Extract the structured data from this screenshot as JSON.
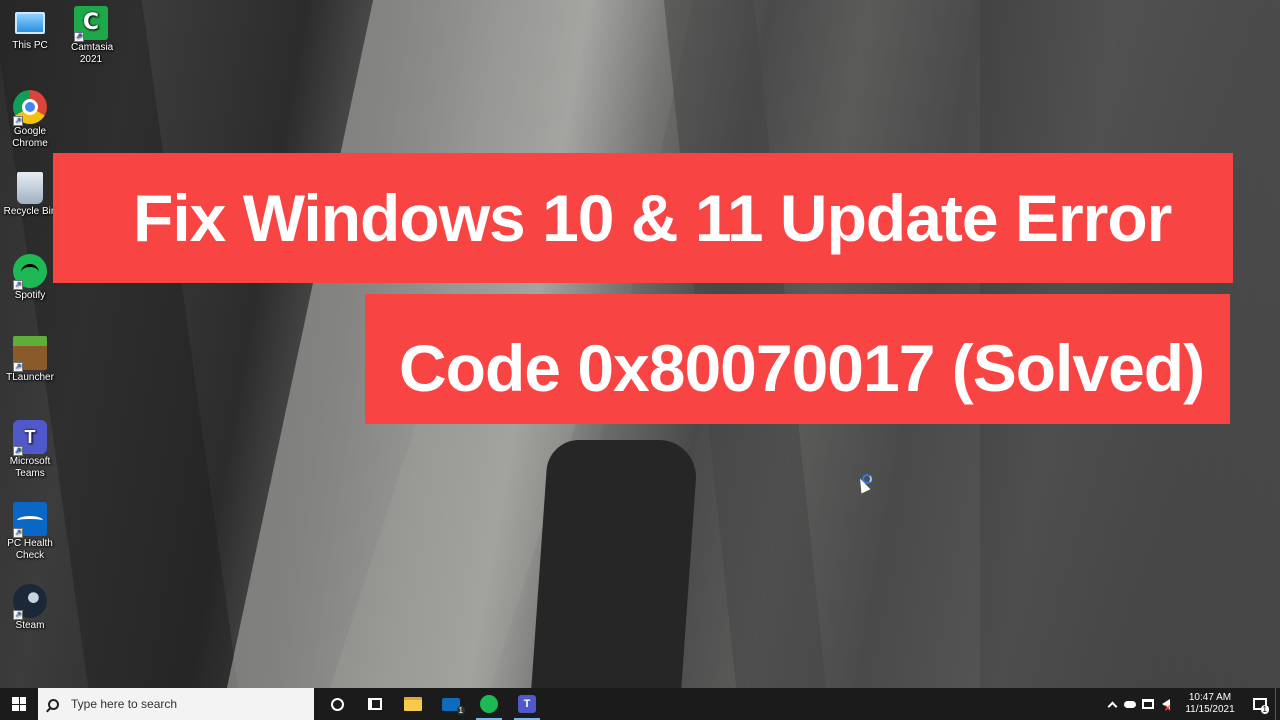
{
  "desktop": {
    "icons": [
      {
        "label": "This PC",
        "icon": "computer-icon"
      },
      {
        "label": "Camtasia 2021",
        "icon": "camtasia-icon"
      },
      {
        "label": "Google Chrome",
        "icon": "chrome-icon"
      },
      {
        "label": "Recycle Bin",
        "icon": "recycle-bin-icon"
      },
      {
        "label": "Spotify",
        "icon": "spotify-icon"
      },
      {
        "label": "TLauncher",
        "icon": "tlauncher-icon"
      },
      {
        "label": "Microsoft Teams",
        "icon": "teams-icon"
      },
      {
        "label": "PC Health Check",
        "icon": "pc-health-check-icon"
      },
      {
        "label": "Steam",
        "icon": "steam-icon"
      }
    ]
  },
  "banner": {
    "line1": "Fix Windows 10 & 11 Update Error",
    "line2": "Code 0x80070017 (Solved)",
    "color": "#f94444"
  },
  "taskbar": {
    "search_placeholder": "Type here to search",
    "pinned": [
      "file-explorer-icon",
      "mail-icon",
      "spotify-icon",
      "teams-icon"
    ],
    "mail_badge": "1",
    "clock": {
      "time": "10:47 AM",
      "date": "11/15/2021"
    },
    "notification_count": "1"
  }
}
